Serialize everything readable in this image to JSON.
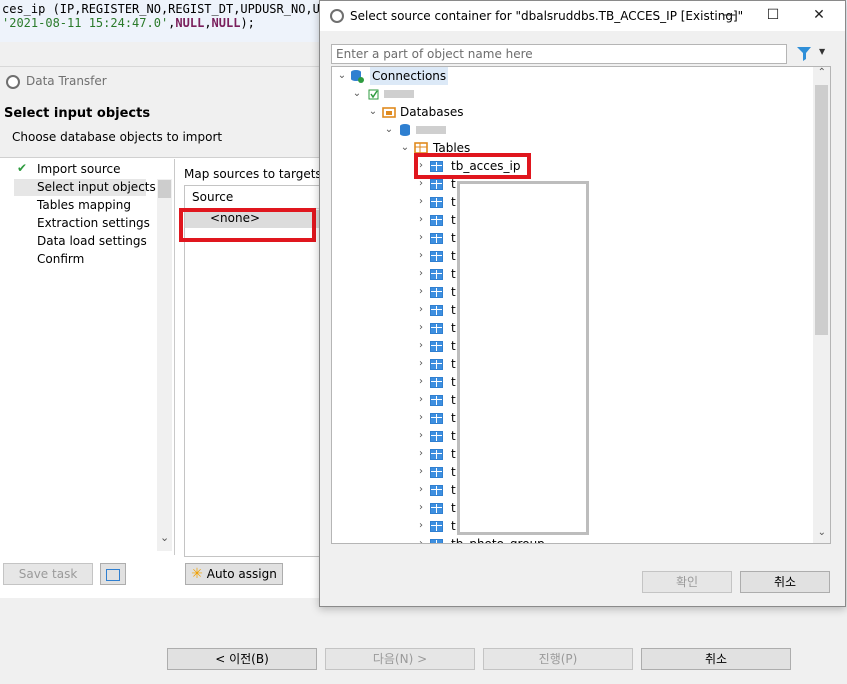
{
  "sql": {
    "line1": "ces_ip (IP,REGISTER_NO,REGIST_DT,UPDUSR_NO,UPD",
    "line2_str": "'2021-08-11 15:24:47.0'",
    "line2_sep1": ",",
    "line2_null1": "NULL",
    "line2_sep2": ",",
    "line2_null2": "NULL",
    "line2_end": ");"
  },
  "data_transfer": {
    "title": "Data Transfer",
    "heading": "Select input objects",
    "subheading": "Choose database objects to import",
    "steps": [
      {
        "label": "Import source",
        "done": true
      },
      {
        "label": "Select input objects",
        "selected": true
      },
      {
        "label": "Tables mapping"
      },
      {
        "label": "Extraction settings"
      },
      {
        "label": "Data load settings"
      },
      {
        "label": "Confirm"
      }
    ],
    "check_mark": "✔",
    "map_label": "Map sources to targets:",
    "source_header": "Source",
    "source_row": "<none>",
    "save_task": "Save task",
    "auto_assign": "Auto assign",
    "auto_assign_glyph": "✳",
    "prev": "< 이전(B)",
    "next": "다음(N) >",
    "proceed": "진행(P)",
    "cancel": "취소"
  },
  "dialog": {
    "title": "Select source container for \"dbalsruddbs.TB_ACCES_IP [Existing]\"",
    "controls": {
      "minimize": "—",
      "maximize": "☐",
      "close": "✕"
    },
    "filter_placeholder": "Enter a part of object name here",
    "filter_glyph": "▼",
    "tree": {
      "connections": "Connections",
      "connection_name": "",
      "databases": "Databases",
      "db_name": "",
      "tables": "Tables",
      "selected_table": "tb_acces_ip",
      "second_table_prefix": "t",
      "table_prefix": "t",
      "last_table": "tb_photo_group"
    },
    "ok": "확인",
    "cancel": "취소"
  },
  "icons": {
    "expanded": "⌄",
    "collapsed": "›",
    "scroll_up": "⌃",
    "scroll_down": "⌄"
  },
  "colors": {
    "highlight": "#e0161e",
    "accent_blue": "#2f7fd0",
    "folder_orange": "#e08a1e"
  }
}
